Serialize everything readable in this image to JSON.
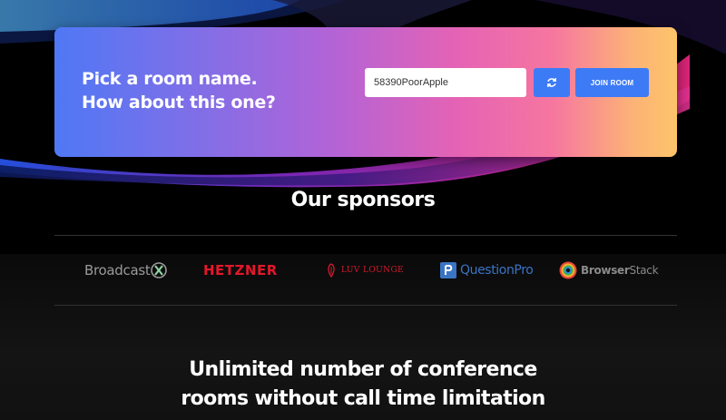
{
  "hero": {
    "title_line1": "Pick a room name.",
    "title_line2": "How about this one?",
    "room_input_value": "58390PoorApple",
    "refresh_icon": "refresh-icon",
    "join_label": "JOIN ROOM"
  },
  "sponsors": {
    "heading": "Our sponsors",
    "items": [
      {
        "name": "Broadcast",
        "icon": "broadcast-x-logo"
      },
      {
        "name": "HETZNER",
        "icon": "hetzner-logo"
      },
      {
        "name": "LUV LOUNGE",
        "icon": "luv-lounge-logo"
      },
      {
        "name": "QuestionPro",
        "icon": "questionpro-logo"
      },
      {
        "name_bold": "Browser",
        "name_light": "Stack",
        "icon": "browserstack-logo"
      }
    ]
  },
  "features": {
    "heading_line1": "Unlimited number of conference",
    "heading_line2": "rooms without call time limitation"
  },
  "colors": {
    "button_blue": "#3d7bf6",
    "hetzner_red": "#e3172a",
    "questionpro_blue": "#3a75c4"
  }
}
